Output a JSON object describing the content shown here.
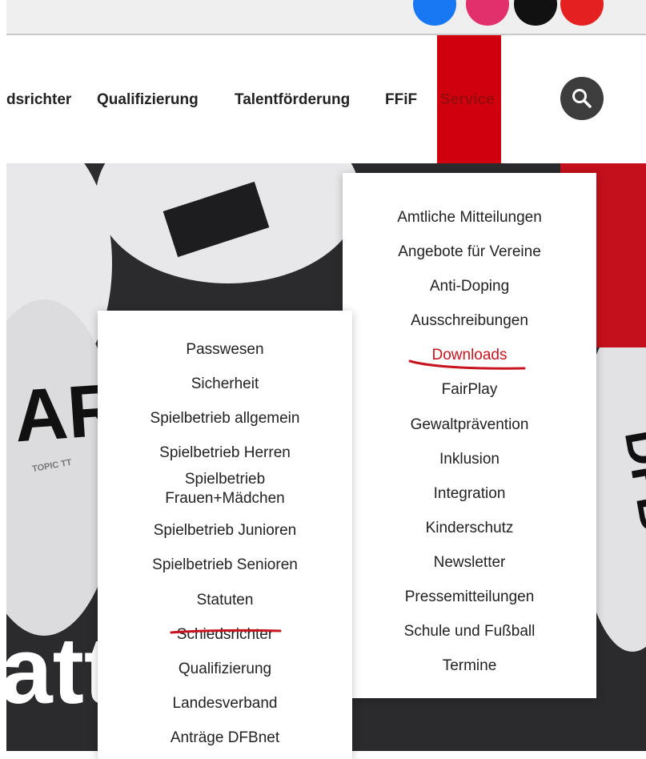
{
  "social": [
    {
      "name": "facebook-icon",
      "color": "#1877f2"
    },
    {
      "name": "instagram-icon",
      "color": "#e1306c"
    },
    {
      "name": "tiktok-icon",
      "color": "#111111"
    },
    {
      "name": "youtube-icon",
      "color": "#e52020"
    }
  ],
  "nav": {
    "items": [
      "dsrichter",
      "Qualifizierung",
      "Talentförderung",
      "FFiF",
      "Service"
    ],
    "active_index": 4,
    "search_icon": "search-icon"
  },
  "hero": {
    "headline": "att",
    "ball_print_1": "AR",
    "ball_print_2": "TOPIC TT",
    "ball_print_3": "DFB"
  },
  "service_menu": {
    "items": [
      "Amtliche Mitteilungen",
      "Angebote für Vereine",
      "Anti-Doping",
      "Ausschreibungen",
      "Downloads",
      "FairPlay",
      "Gewaltprävention",
      "Inklusion",
      "Integration",
      "Kinderschutz",
      "Newsletter",
      "Pressemitteilungen",
      "Schule und Fußball",
      "Termine"
    ],
    "highlighted": "Downloads"
  },
  "downloads_submenu": {
    "items": [
      "Passwesen",
      "Sicherheit",
      "Spielbetrieb allgemein",
      "Spielbetrieb Herren",
      "Spielbetrieb Frauen+Mädchen",
      "Spielbetrieb Junioren",
      "Spielbetrieb Senioren",
      "Statuten",
      "Schiedsrichter",
      "Qualifizierung",
      "Landesverband",
      "Anträge DFBnet"
    ],
    "highlighted": "Statuten"
  },
  "colors": {
    "brand_red": "#d0000e",
    "annotation_red": "#c8141e",
    "text": "#222222"
  }
}
